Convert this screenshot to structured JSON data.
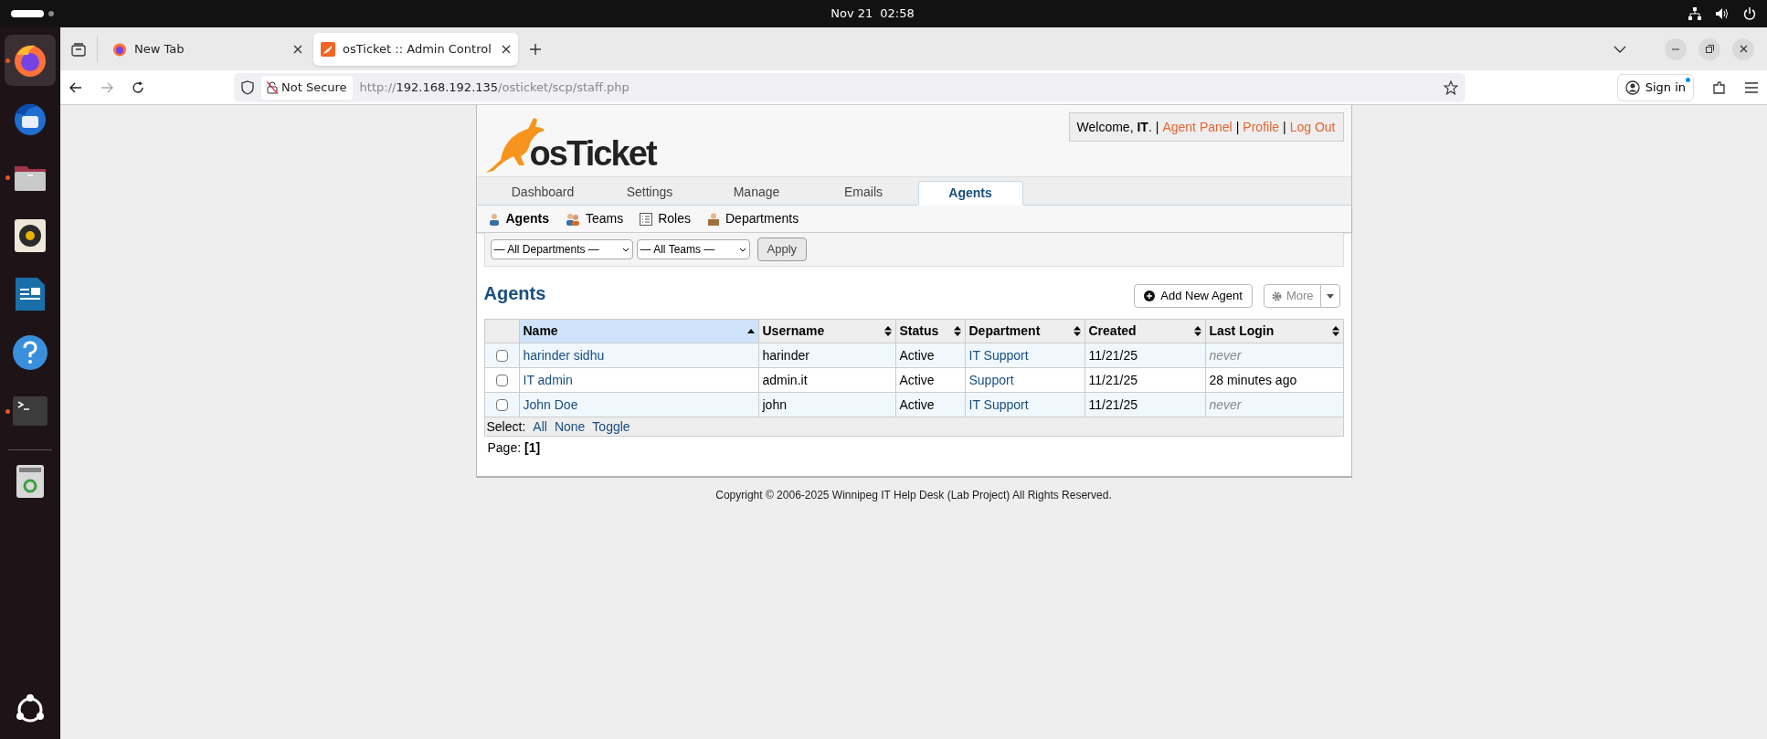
{
  "top_bar": {
    "date": "Nov 21",
    "time": "02:58"
  },
  "dock": [
    {
      "kind": "firefox",
      "running": true,
      "selected": true
    },
    {
      "kind": "thunderbird",
      "running": false,
      "selected": false
    },
    {
      "kind": "files",
      "running": true,
      "selected": false
    },
    {
      "kind": "rhythmbox",
      "running": false,
      "selected": false
    },
    {
      "kind": "writer",
      "running": false,
      "selected": false
    },
    {
      "kind": "help",
      "running": false,
      "selected": false
    },
    {
      "kind": "terminal",
      "running": true,
      "selected": false
    },
    {
      "kind": "trash",
      "running": false,
      "selected": false
    }
  ],
  "browser": {
    "tabs": [
      {
        "title": "New Tab",
        "kind": "firefox",
        "selected": false
      },
      {
        "title": "osTicket :: Admin Control",
        "kind": "osticket",
        "selected": true
      }
    ],
    "security": "Not Secure",
    "url": {
      "scheme": "http://",
      "host": "192.168.192.135",
      "path": "/osticket/scp/staff.php"
    },
    "sign_in": "Sign in"
  },
  "header": {
    "logo": "osTicket",
    "welcome": "Welcome, **IT**.",
    "links": [
      {
        "separator": "|",
        "label": "Agent Panel"
      },
      {
        "separator": "|",
        "label": "Profile"
      },
      {
        "separator": "|",
        "label": "Log Out"
      }
    ]
  },
  "nav_tabs": [
    {
      "label": "Dashboard",
      "selected": false
    },
    {
      "label": "Settings",
      "selected": false
    },
    {
      "label": "Manage",
      "selected": false
    },
    {
      "label": "Emails",
      "selected": false
    },
    {
      "label": "Agents",
      "selected": true
    }
  ],
  "sub_nav": [
    {
      "label": "Agents",
      "kind": "agent",
      "selected": true
    },
    {
      "label": "Teams",
      "kind": "team",
      "selected": false
    },
    {
      "label": "Roles",
      "kind": "roles",
      "selected": false
    },
    {
      "label": "Departments",
      "kind": "department",
      "selected": false
    }
  ],
  "filters": {
    "department": "— All Departments —",
    "team": "— All Teams —",
    "apply": "Apply"
  },
  "title": "Agents",
  "add_button": "Add New Agent",
  "more_button": "More",
  "table": {
    "columns": [
      {
        "label": "Name",
        "selected": true
      },
      {
        "label": "Username",
        "selected": false
      },
      {
        "label": "Status",
        "selected": false
      },
      {
        "label": "Department",
        "selected": false
      },
      {
        "label": "Created",
        "selected": false
      },
      {
        "label": "Last Login",
        "selected": false
      }
    ],
    "rows": [
      {
        "checked": false,
        "name": "harinder sidhu",
        "username": "harinder",
        "status": "Active",
        "department": "IT Support",
        "created": "11/21/25",
        "last_login": "never",
        "last_login_muted": true
      },
      {
        "checked": false,
        "name": "IT admin",
        "username": "admin.it",
        "status": "Active",
        "department": "Support",
        "created": "11/21/25",
        "last_login": "28 minutes ago",
        "last_login_muted": false
      },
      {
        "checked": false,
        "name": "John Doe",
        "username": "john",
        "status": "Active",
        "department": "IT Support",
        "created": "11/21/25",
        "last_login": "never",
        "last_login_muted": true
      }
    ]
  },
  "select": {
    "label": "Select:",
    "links": [
      "All",
      "None",
      "Toggle"
    ]
  },
  "pagination": {
    "label": "Page:",
    "current": "[1]"
  },
  "footer": "Copyright © 2006-2025 Winnipeg IT Help Desk (Lab Project) All Rights Reserved."
}
